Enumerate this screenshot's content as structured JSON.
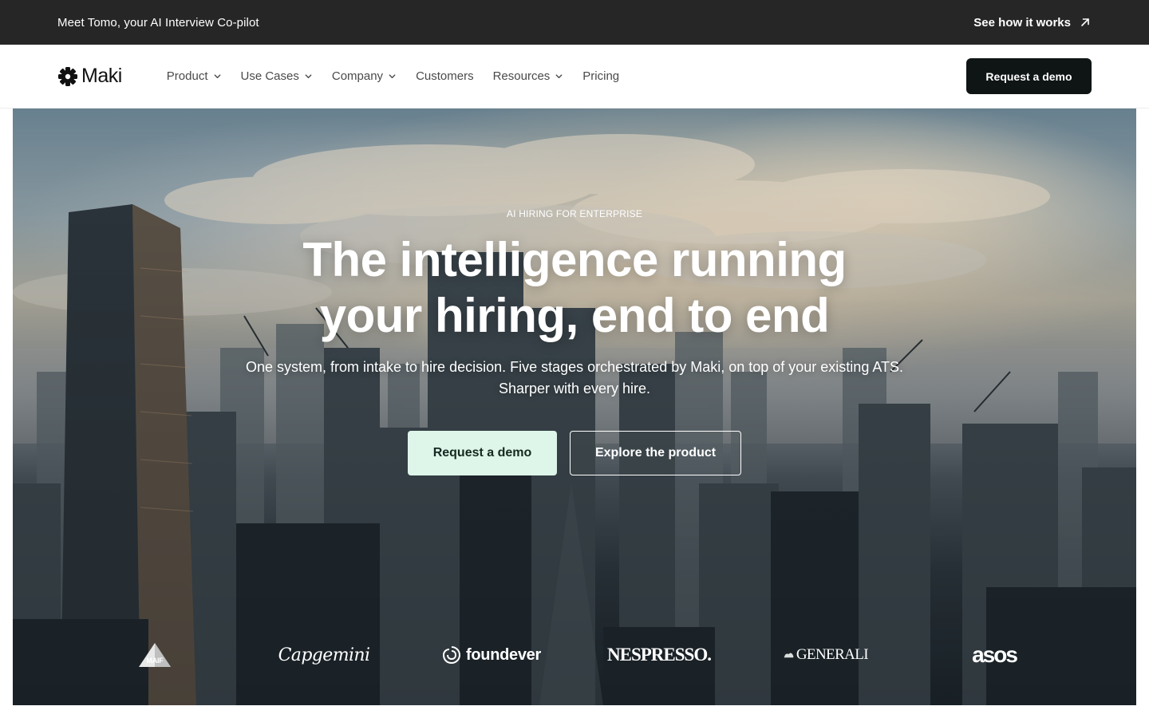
{
  "announcement": {
    "message": "Meet Tomo, your AI Interview Co-pilot",
    "cta_label": "See how it works",
    "cta_icon": "arrow-up-right-icon"
  },
  "nav": {
    "logo_text": "Maki",
    "logo_icon": "maki-mark-icon",
    "items": [
      {
        "label": "Product",
        "has_dropdown": true
      },
      {
        "label": "Use Cases",
        "has_dropdown": true
      },
      {
        "label": "Company",
        "has_dropdown": true
      },
      {
        "label": "Customers",
        "has_dropdown": false
      },
      {
        "label": "Resources",
        "has_dropdown": true
      },
      {
        "label": "Pricing",
        "has_dropdown": false
      }
    ],
    "cta_label": "Request a demo"
  },
  "hero": {
    "eyebrow": "AI HIRING FOR ENTERPRISE",
    "headline_line1": "The intelligence running",
    "headline_line2": "your hiring, end to end",
    "subheadline": "One system, from intake to hire decision. Five stages orchestrated by Maki, on top of your existing ATS. Sharper with every hire.",
    "primary_cta": "Request a demo",
    "secondary_cta": "Explore the product",
    "background": "aerial city skyline at sunset"
  },
  "customer_logos": {
    "maif": "MAIF",
    "capgemini": "Capgemini",
    "foundever": "foundever",
    "nespresso": "NESPRESSO.",
    "generali": "GENERALI",
    "asos": "asos"
  },
  "colors": {
    "announcement_bg": "#262626",
    "nav_cta_bg": "#0f1414",
    "hero_primary_bg": "#def5e9",
    "hero_primary_text": "#152a20"
  }
}
